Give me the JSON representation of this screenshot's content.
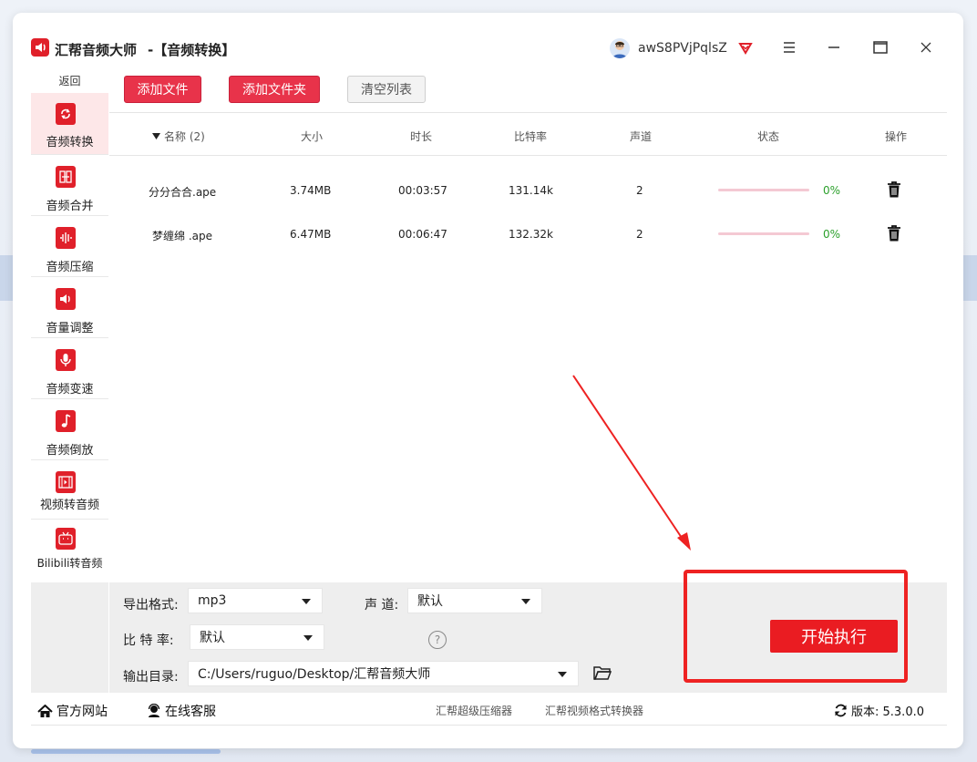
{
  "window": {
    "app_name": "汇帮音频大师",
    "page_title": "-【音频转换】",
    "username": "awS8PVjPqlsZ"
  },
  "sidebar": {
    "back_label": "返回",
    "items": [
      {
        "label": "音频转换",
        "icon": "audio-convert-icon",
        "active": true
      },
      {
        "label": "音频合并",
        "icon": "audio-merge-icon"
      },
      {
        "label": "音频压缩",
        "icon": "audio-compress-icon"
      },
      {
        "label": "音量调整",
        "icon": "volume-icon"
      },
      {
        "label": "音频变速",
        "icon": "microphone-icon"
      },
      {
        "label": "音频倒放",
        "icon": "music-note-icon"
      },
      {
        "label": "视频转音频",
        "icon": "film-icon"
      },
      {
        "label": "Bilibili转音频",
        "icon": "tv-icon"
      }
    ]
  },
  "toolbar": {
    "add_file": "添加文件",
    "add_folder": "添加文件夹",
    "clear_list": "清空列表"
  },
  "table": {
    "headers": {
      "name": "名称 (2)",
      "size": "大小",
      "duration": "时长",
      "bitrate": "比特率",
      "channels": "声道",
      "status": "状态",
      "actions": "操作"
    },
    "rows": [
      {
        "name": "分分合合.ape",
        "size": "3.74MB",
        "duration": "00:03:57",
        "bitrate": "131.14k",
        "channels": "2",
        "progress": 0,
        "progress_text": "0%"
      },
      {
        "name": "梦缠绵 .ape",
        "size": "6.47MB",
        "duration": "00:06:47",
        "bitrate": "132.32k",
        "channels": "2",
        "progress": 0,
        "progress_text": "0%"
      }
    ]
  },
  "settings": {
    "format_label": "导出格式:",
    "format_value": "mp3",
    "channel_label": "声 道:",
    "channel_value": "默认",
    "bitrate_label": "比 特 率:",
    "bitrate_value": "默认",
    "output_label": "输出目录:",
    "output_value": "C:/Users/ruguo/Desktop/汇帮音频大师",
    "start_button": "开始执行"
  },
  "statusbar": {
    "website": "官方网站",
    "support": "在线客服",
    "link1": "汇帮超级压缩器",
    "link2": "汇帮视频格式转换器",
    "version": "版本: 5.3.0.0"
  },
  "colors": {
    "accent": "#e8334a",
    "start": "#ea1c22",
    "progress_track": "#f4c9d3",
    "percent_text": "#2ca02c",
    "annotation": "#ee2222"
  }
}
